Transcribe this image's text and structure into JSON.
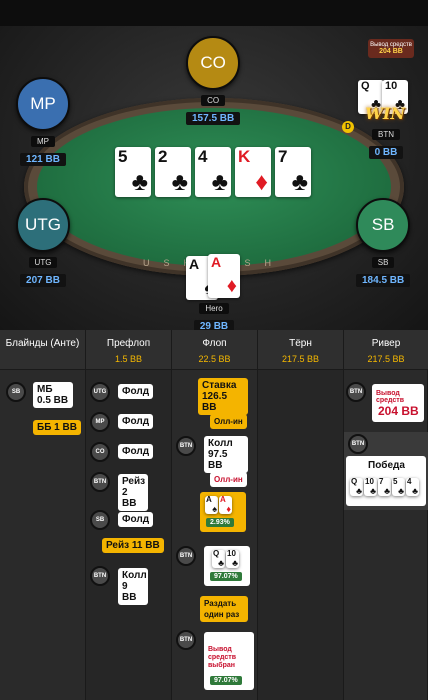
{
  "table": {
    "rail_text": "USHCASH",
    "seats": {
      "co": {
        "name": "CO",
        "avatar": "CO",
        "stack": "157.5 BB",
        "color": "#b58a13"
      },
      "mp": {
        "name": "MP",
        "avatar": "MP",
        "stack": "121 BB",
        "color": "#3a6fb0"
      },
      "btn": {
        "name": "BTN",
        "stack": "0 BB"
      },
      "utg": {
        "name": "UTG",
        "avatar": "UTG",
        "stack": "207 BB",
        "color": "#2d6f7a"
      },
      "sb": {
        "name": "SB",
        "avatar": "SB",
        "stack": "184.5 BB",
        "color": "#2f8a5a"
      },
      "hero": {
        "name": "Hero",
        "stack": "29 BB"
      }
    },
    "board": [
      {
        "rank": "5",
        "suit": "♣",
        "color": "black"
      },
      {
        "rank": "2",
        "suit": "♣",
        "color": "black"
      },
      {
        "rank": "4",
        "suit": "♣",
        "color": "black"
      },
      {
        "rank": "K",
        "suit": "♦",
        "color": "red"
      },
      {
        "rank": "7",
        "suit": "♣",
        "color": "black"
      }
    ],
    "hero_cards": [
      {
        "rank": "A",
        "suit": "♠",
        "color": "black"
      },
      {
        "rank": "A",
        "suit": "♦",
        "color": "red"
      }
    ],
    "btn_cards": [
      {
        "rank": "Q",
        "suit": "♣"
      },
      {
        "rank": "10",
        "suit": "♣"
      }
    ],
    "win_text": "WIN",
    "dealer_chip": "D",
    "withdraw": {
      "label": "Вывод средств",
      "value": "204 BB"
    }
  },
  "history": {
    "columns": [
      {
        "title": "Блайнды (Анте)",
        "pot": ""
      },
      {
        "title": "Префлоп",
        "pot": "1.5 BB"
      },
      {
        "title": "Флоп",
        "pot": "22.5 BB"
      },
      {
        "title": "Тёрн",
        "pot": "217.5 BB"
      },
      {
        "title": "Ривер",
        "pot": "217.5 BB"
      }
    ],
    "blinds": {
      "sb_chip": "SB",
      "sb_action": "МБ 0.5 BB",
      "bb_action": "ББ 1 BB"
    },
    "preflop": [
      {
        "chip": "UTG",
        "action": "Фолд"
      },
      {
        "chip": "MP",
        "action": "Фолд"
      },
      {
        "chip": "CO",
        "action": "Фолд"
      },
      {
        "chip": "BTN",
        "action": "Рейз 2 BB"
      },
      {
        "chip": "SB",
        "action": "Фолд"
      },
      {
        "hero_action": "Рейз 11 BB"
      },
      {
        "chip": "BTN",
        "action": "Колл 9 BB"
      }
    ],
    "flop": {
      "bet": "Ставка 126.5 BB",
      "allin1": "Олл-ин",
      "btn_chip": "BTN",
      "call": "Колл 97.5 BB",
      "allin2": "Олл-ин",
      "hero_cards": [
        {
          "rank": "A",
          "suit": "♠"
        },
        {
          "rank": "A",
          "suit": "♦"
        }
      ],
      "hero_eq": "2.93%",
      "btn_chip2": "BTN",
      "btn_cards": [
        {
          "rank": "Q",
          "suit": "♣"
        },
        {
          "rank": "10",
          "suit": "♣"
        }
      ],
      "btn_eq": "97.07%",
      "once": "Раздать один раз",
      "btn_chip3": "BTN",
      "withdraw_sel": "Вывод средств выбран",
      "btn_eq2": "97.07%"
    },
    "river": {
      "chip": "BTN",
      "withdraw_label": "Вывод средств",
      "withdraw_value": "204 BB",
      "chip2": "BTN",
      "win_label": "Победа",
      "win_cards": [
        {
          "rank": "Q",
          "suit": "♣"
        },
        {
          "rank": "10",
          "suit": "♣"
        },
        {
          "rank": "7",
          "suit": "♣"
        },
        {
          "rank": "5",
          "suit": "♣"
        },
        {
          "rank": "4",
          "suit": "♣"
        }
      ]
    }
  }
}
